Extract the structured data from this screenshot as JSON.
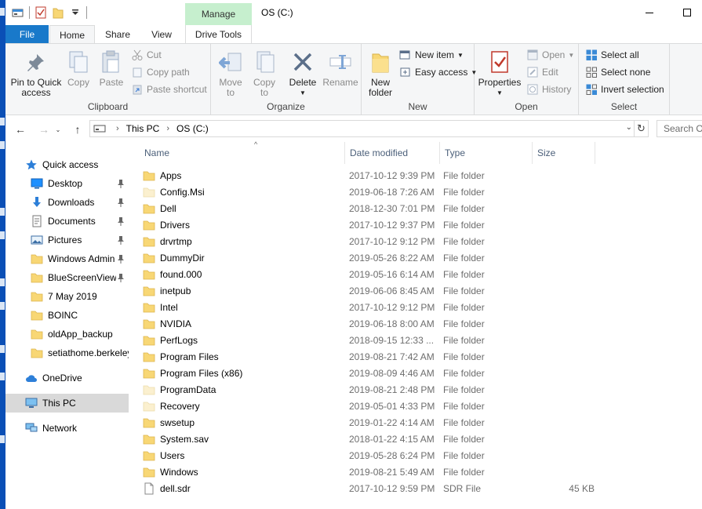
{
  "window": {
    "title": "OS (C:)",
    "manage_tab": "Manage",
    "minimize_icon": "minimize-icon",
    "maximize_icon": "maximize-icon"
  },
  "tabs": {
    "file": "File",
    "home": "Home",
    "share": "Share",
    "view": "View",
    "drive_tools": "Drive Tools"
  },
  "ribbon": {
    "clipboard": {
      "label": "Clipboard",
      "pin_line1": "Pin to Quick",
      "pin_line2": "access",
      "copy": "Copy",
      "paste": "Paste",
      "cut": "Cut",
      "copy_path": "Copy path",
      "paste_shortcut": "Paste shortcut"
    },
    "organize": {
      "label": "Organize",
      "move_to": "Move",
      "move_to2": "to",
      "copy_to": "Copy",
      "copy_to2": "to",
      "delete": "Delete",
      "rename": "Rename"
    },
    "new": {
      "label": "New",
      "new_folder1": "New",
      "new_folder2": "folder",
      "new_item": "New item",
      "easy_access": "Easy access"
    },
    "open": {
      "label": "Open",
      "properties": "Properties",
      "open": "Open",
      "edit": "Edit",
      "history": "History"
    },
    "select": {
      "label": "Select",
      "select_all": "Select all",
      "select_none": "Select none",
      "invert": "Invert selection"
    }
  },
  "address": {
    "crumbs": [
      "This PC",
      "OS (C:)"
    ],
    "search_placeholder": "Search OS (C:)"
  },
  "nav": {
    "quick_access": "Quick access",
    "items": [
      {
        "label": "Desktop",
        "icon": "desktop-icon",
        "pinned": true
      },
      {
        "label": "Downloads",
        "icon": "downloads-icon",
        "pinned": true
      },
      {
        "label": "Documents",
        "icon": "documents-icon",
        "pinned": true
      },
      {
        "label": "Pictures",
        "icon": "pictures-icon",
        "pinned": true
      },
      {
        "label": "Windows Admin",
        "icon": "folder-icon",
        "pinned": true
      },
      {
        "label": "BlueScreenView",
        "icon": "folder-icon",
        "pinned": true
      },
      {
        "label": "7 May 2019",
        "icon": "folder-icon",
        "pinned": false
      },
      {
        "label": "BOINC",
        "icon": "folder-icon",
        "pinned": false
      },
      {
        "label": "oldApp_backup",
        "icon": "folder-icon",
        "pinned": false
      },
      {
        "label": "setiathome.berkeley",
        "icon": "folder-icon",
        "pinned": false
      }
    ],
    "onedrive": "OneDrive",
    "this_pc": "This PC",
    "network": "Network"
  },
  "columns": {
    "name": "Name",
    "date": "Date modified",
    "type": "Type",
    "size": "Size"
  },
  "files": [
    {
      "name": "Apps",
      "date": "2017-10-12 9:39 PM",
      "type": "File folder",
      "size": "",
      "icon": "folder-icon"
    },
    {
      "name": "Config.Msi",
      "date": "2019-06-18 7:26 AM",
      "type": "File folder",
      "size": "",
      "icon": "folder-hidden-icon"
    },
    {
      "name": "Dell",
      "date": "2018-12-30 7:01 PM",
      "type": "File folder",
      "size": "",
      "icon": "folder-icon"
    },
    {
      "name": "Drivers",
      "date": "2017-10-12 9:37 PM",
      "type": "File folder",
      "size": "",
      "icon": "folder-icon"
    },
    {
      "name": "drvrtmp",
      "date": "2017-10-12 9:12 PM",
      "type": "File folder",
      "size": "",
      "icon": "folder-icon"
    },
    {
      "name": "DummyDir",
      "date": "2019-05-26 8:22 AM",
      "type": "File folder",
      "size": "",
      "icon": "folder-icon"
    },
    {
      "name": "found.000",
      "date": "2019-05-16 6:14 AM",
      "type": "File folder",
      "size": "",
      "icon": "folder-icon"
    },
    {
      "name": "inetpub",
      "date": "2019-06-06 8:45 AM",
      "type": "File folder",
      "size": "",
      "icon": "folder-icon"
    },
    {
      "name": "Intel",
      "date": "2017-10-12 9:12 PM",
      "type": "File folder",
      "size": "",
      "icon": "folder-icon"
    },
    {
      "name": "NVIDIA",
      "date": "2019-06-18 8:00 AM",
      "type": "File folder",
      "size": "",
      "icon": "folder-icon"
    },
    {
      "name": "PerfLogs",
      "date": "2018-09-15 12:33 ...",
      "type": "File folder",
      "size": "",
      "icon": "folder-icon"
    },
    {
      "name": "Program Files",
      "date": "2019-08-21 7:42 AM",
      "type": "File folder",
      "size": "",
      "icon": "folder-icon"
    },
    {
      "name": "Program Files (x86)",
      "date": "2019-08-09 4:46 AM",
      "type": "File folder",
      "size": "",
      "icon": "folder-icon"
    },
    {
      "name": "ProgramData",
      "date": "2019-08-21 2:48 PM",
      "type": "File folder",
      "size": "",
      "icon": "folder-hidden-icon"
    },
    {
      "name": "Recovery",
      "date": "2019-05-01 4:33 PM",
      "type": "File folder",
      "size": "",
      "icon": "folder-hidden-icon"
    },
    {
      "name": "swsetup",
      "date": "2019-01-22 4:14 AM",
      "type": "File folder",
      "size": "",
      "icon": "folder-icon"
    },
    {
      "name": "System.sav",
      "date": "2018-01-22 4:15 AM",
      "type": "File folder",
      "size": "",
      "icon": "folder-icon"
    },
    {
      "name": "Users",
      "date": "2019-05-28 6:24 PM",
      "type": "File folder",
      "size": "",
      "icon": "folder-icon"
    },
    {
      "name": "Windows",
      "date": "2019-08-21 5:49 AM",
      "type": "File folder",
      "size": "",
      "icon": "folder-icon"
    },
    {
      "name": "dell.sdr",
      "date": "2017-10-12 9:59 PM",
      "type": "SDR File",
      "size": "45 KB",
      "icon": "file-icon"
    }
  ],
  "colors": {
    "accent": "#1979ca",
    "manage_tab": "#c6efce",
    "folder": "#f8d775",
    "selection": "#d9d9d9"
  }
}
